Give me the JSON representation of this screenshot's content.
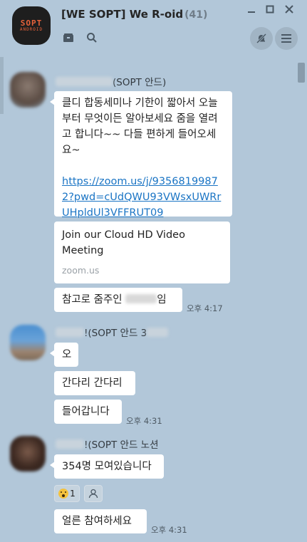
{
  "header": {
    "title": "[WE SOPT] We R-oid",
    "member_count": "(41)",
    "app_icon_line1": "SOPT",
    "app_icon_line2": "ANDROID"
  },
  "messages": {
    "m1": {
      "sender_suffix": "(SOPT 안드)",
      "bubble1_text": "클디 합동세미나 기한이 짧아서 오늘부터 무엇이든 알아보세요 줌을 열려고 합니다~~ 다들 편하게 들어오세요~",
      "link": "https://zoom.us/j/93568199872?pwd=cUdQWU93VWsxUWRrUHpldUl3VFFRUT09",
      "preview_title": "Join our Cloud HD Video Meeting",
      "preview_domain": "zoom.us",
      "bubble3_prefix": "참고로 줌주인",
      "bubble3_suffix": "임",
      "time": "오후 4:17"
    },
    "m2": {
      "sender_suffix": "!(SOPT 안드 3",
      "bubble1_text": "오",
      "bubble2_text": "간다리 간다리",
      "bubble3_text": "들어갑니다",
      "time": "오후 4:31"
    },
    "m3": {
      "sender_suffix": "!(SOPT 안드 노션",
      "bubble1_text": "354명 모여있습니다",
      "reaction_count": "1",
      "bubble2_text": "얼른 참여하세요",
      "time": "오후 4:31"
    }
  },
  "colors": {
    "background": "#b2c7d9",
    "bubble": "#ffffff",
    "link": "#1a74c4",
    "app_icon_accent": "#e8623a"
  },
  "icons": [
    "folder-icon",
    "search-icon",
    "minimize-icon",
    "maximize-icon",
    "close-icon",
    "notifications-off-icon",
    "menu-icon",
    "person-icon",
    "surprised-emoji-icon"
  ]
}
